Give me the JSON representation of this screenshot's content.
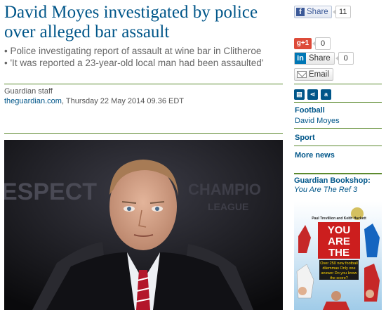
{
  "article": {
    "headline": "David Moyes investigated by police over alleged bar assault",
    "standfirst": [
      "Police investigating report of assault at wine bar in Clitheroe",
      "'It was reported a 23-year-old local man had been assaulted'"
    ],
    "author": "Guardian staff",
    "publication": "theguardian.com",
    "dateline": ", Thursday 22 May 2014 09.36 EDT",
    "photo_background_text": [
      "ESPECT",
      "CHAMPIO",
      "LEAGUE"
    ]
  },
  "share": {
    "facebook_label": "Share",
    "facebook_count": "11",
    "gplus_label": "g+1",
    "gplus_count": "0",
    "linkedin_label": "Share",
    "linkedin_count": "0",
    "email_label": "Email"
  },
  "sidebar": {
    "section1": {
      "title": "Football",
      "item": "David Moyes"
    },
    "section2": {
      "title": "Sport"
    },
    "section3": {
      "title": "More news"
    },
    "bookshop": {
      "title": "Guardian Bookshop:",
      "book": "You Are The Ref 3",
      "cover_authors": "Paul Trevillion and Keith Hackett",
      "cover_title": "YOU ARE THE REF",
      "cover_tagline": "Over 250 new football dilemmas Only one answer Do you know the score?"
    }
  },
  "colors": {
    "link": "#005689",
    "rule": "#5c8a2e",
    "facebook": "#3b5998",
    "gplus": "#dd4b39",
    "linkedin": "#0077b5"
  }
}
